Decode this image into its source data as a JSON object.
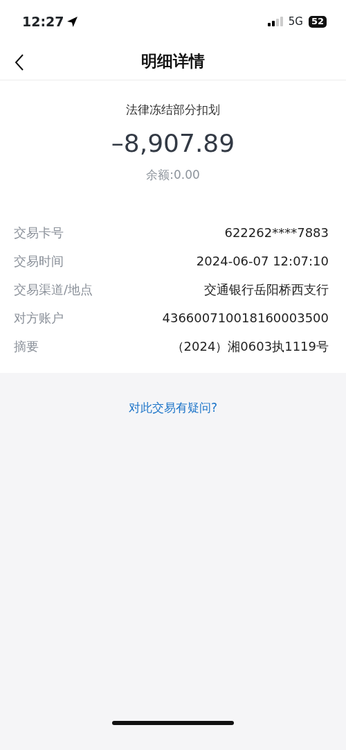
{
  "status_bar": {
    "time": "12:27",
    "network": "5G",
    "battery": "52"
  },
  "nav": {
    "title": "明细详情"
  },
  "summary": {
    "type": "法律冻结部分扣划",
    "amount": "–8,907.89",
    "balance": "余额:0.00"
  },
  "details": [
    {
      "label": "交易卡号",
      "value": "622262****7883"
    },
    {
      "label": "交易时间",
      "value": "2024-06-07 12:07:10"
    },
    {
      "label": "交易渠道/地点",
      "value": "交通银行岳阳桥西支行"
    },
    {
      "label": "对方账户",
      "value": "436600710018160003500"
    },
    {
      "label": "摘要",
      "value": "（2024）湘0603执1119号"
    }
  ],
  "help_link": "对此交易有疑问?"
}
